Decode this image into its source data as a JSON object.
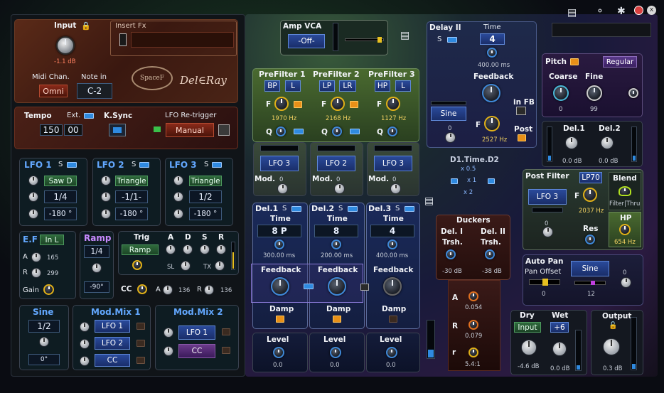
{
  "input": {
    "title": "Input",
    "value": "-1.1 dB"
  },
  "insert": {
    "title": "Insert Fx"
  },
  "midi": {
    "chan_label": "Midi Chan.",
    "chan_value": "Omni",
    "note_label": "Note in",
    "note_value": "C-2"
  },
  "logo": {
    "spacef": "SpaceF",
    "delray": "Del∈Ray"
  },
  "tempo": {
    "label": "Tempo",
    "ext": "Ext.",
    "value": "150",
    "frac": "00",
    "ksync": "K.Sync",
    "retrig": "LFO Re-trigger",
    "retrig_value": "Manual"
  },
  "lfos": [
    {
      "title": "LFO 1",
      "s": "S",
      "wave": "Saw D",
      "rate": "1/4",
      "phase": "-180 °"
    },
    {
      "title": "LFO 2",
      "s": "S",
      "wave": "Triangle",
      "rate": "-1/1-",
      "phase": "-180 °"
    },
    {
      "title": "LFO 3",
      "s": "S",
      "wave": "Triangle",
      "rate": "1/2",
      "phase": "-180 °"
    }
  ],
  "ef": {
    "title": "E.F",
    "mode": "In L",
    "a_label": "A",
    "a_value": "165",
    "r_label": "R",
    "r_value": "299",
    "gain": "Gain"
  },
  "ramp": {
    "title": "Ramp",
    "rate": "1/4",
    "phase": "-90°"
  },
  "trig": {
    "title": "Trig",
    "mode": "Ramp",
    "a": "A",
    "d": "D",
    "s": "S",
    "r": "R",
    "sl": "SL",
    "tx": "TX",
    "cc": "CC",
    "cc_a_label": "A",
    "cc_a": "136",
    "cc_r_label": "R",
    "cc_r": "136"
  },
  "sine": {
    "title": "Sine",
    "rate": "1/2",
    "phase": "0°"
  },
  "modmix1": {
    "title": "Mod.Mix 1",
    "items": [
      "LFO 1",
      "LFO 2",
      "CC"
    ]
  },
  "modmix2": {
    "title": "Mod.Mix 2",
    "items": [
      "LFO 1",
      "CC"
    ]
  },
  "amp": {
    "title": "Amp VCA",
    "value": "-Off-"
  },
  "prefilters": [
    {
      "title": "PreFilter 1",
      "type": "BP",
      "ch": "L",
      "f": "F",
      "hz": "1970 Hz",
      "q": "Q",
      "mod_src": "LFO 3",
      "mod": "Mod.",
      "mod_val": "0"
    },
    {
      "title": "PreFilter 2",
      "type": "LP",
      "ch": "LR",
      "f": "F",
      "hz": "2168 Hz",
      "q": "Q",
      "mod_src": "LFO 2",
      "mod": "Mod.",
      "mod_val": "0"
    },
    {
      "title": "PreFilter 3",
      "type": "HP",
      "ch": "L",
      "f": "F",
      "hz": "1127 Hz",
      "q": "Q",
      "mod_src": "LFO 3",
      "mod": "Mod.",
      "mod_val": "0"
    }
  ],
  "delays": [
    {
      "title": "Del.1",
      "s": "S",
      "time_label": "Time",
      "time": "8 P",
      "ms": "300.00 ms",
      "fb": "Feedback",
      "damp": "Damp",
      "level": "Level",
      "level_val": "0.0"
    },
    {
      "title": "Del.2",
      "s": "S",
      "time_label": "Time",
      "time": "8",
      "ms": "200.00 ms",
      "fb": "Feedback",
      "damp": "Damp",
      "level": "Level",
      "level_val": "0.0"
    },
    {
      "title": "Del.3",
      "s": "S",
      "time_label": "Time",
      "time": "4",
      "ms": "400.00 ms",
      "fb": "Feedback",
      "damp": "Damp",
      "level": "Level",
      "level_val": "0.0"
    }
  ],
  "delay2": {
    "title": "Delay II",
    "s": "S",
    "time_label": "Time",
    "time": "4",
    "ms": "400.00 ms",
    "fb": "Feedback",
    "wave": "Sine",
    "f": "F",
    "hz": "2527 Hz",
    "infb": "in FB",
    "post": "Post",
    "mod_val": "0"
  },
  "dtime": {
    "title": "D1.Time.D2",
    "x05": "x 0.5",
    "x1": "x 1",
    "x2": "x 2"
  },
  "duckers": {
    "title": "Duckers",
    "d1": "Del. I",
    "d2": "Del. II",
    "trsh": "Trsh.",
    "v1": "-30 dB",
    "v2": "-38 dB",
    "a": "A",
    "a_val": "0.054",
    "r": "R",
    "r_val": "0.079",
    "ratio": "r",
    "ratio_val": "5.4:1"
  },
  "pitch": {
    "title": "Pitch",
    "mode": "Regular",
    "coarse": "Coarse",
    "coarse_val": "0",
    "fine": "Fine",
    "fine_val": "99"
  },
  "dels": {
    "d1": "Del.1",
    "d2": "Del.2",
    "v1": "0.0 dB",
    "v2": "0.0 dB"
  },
  "postfilter": {
    "title": "Post Filter",
    "type": "LP70",
    "src": "LFO 3",
    "f": "F",
    "hz": "2037 Hz",
    "res": "Res",
    "blend": "Blend",
    "ft": "Filter|Thru",
    "hp": "HP",
    "hp_hz": "654 Hz",
    "mod_val": "0"
  },
  "autopan": {
    "title": "Auto Pan",
    "offset": "Pan Offset",
    "offset_val": "0",
    "wave": "Sine",
    "rate": "12",
    "mod_val": "0"
  },
  "drywet": {
    "dry": "Dry",
    "wet": "Wet",
    "dry_src": "Input",
    "wet_val": "+6",
    "dry_db": "-4.6 dB",
    "wet_db": "0.0 dB"
  },
  "output": {
    "title": "Output",
    "value": "0.3 dB"
  }
}
